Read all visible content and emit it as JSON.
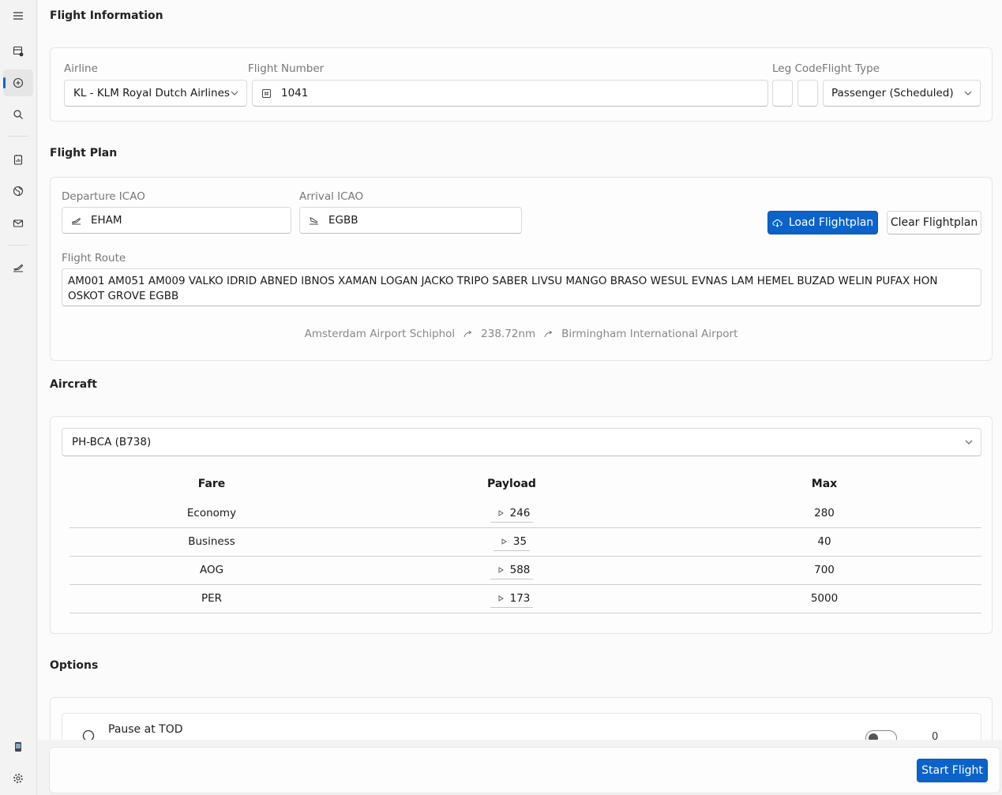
{
  "sidebar": {
    "items": [
      {
        "name": "menu-icon"
      },
      {
        "name": "dispatch-icon"
      },
      {
        "name": "flight-icon"
      },
      {
        "name": "search-icon"
      },
      {
        "name": "report-icon"
      },
      {
        "name": "globe-icon"
      },
      {
        "name": "mail-icon"
      },
      {
        "name": "logbook-icon"
      },
      {
        "name": "device-icon"
      },
      {
        "name": "settings-icon"
      }
    ]
  },
  "flight_info": {
    "title": "Flight Information",
    "airline_label": "Airline",
    "airline_value": "KL - KLM Royal Dutch Airlines",
    "flight_number_label": "Flight Number",
    "flight_number_value": "1041",
    "leg_code_label": "Leg Code",
    "flight_type_label": "Flight Type",
    "flight_type_value": "Passenger (Scheduled)"
  },
  "flight_plan": {
    "title": "Flight Plan",
    "departure_label": "Departure ICAO",
    "departure_value": "EHAM",
    "arrival_label": "Arrival ICAO",
    "arrival_value": "EGBB",
    "load_button": "Load Flightplan",
    "clear_button": "Clear Flightplan",
    "route_label": "Flight Route",
    "route_value": "AM001 AM051 AM009 VALKO IDRID ABNED IBNOS XAMAN LOGAN JACKO TRIPO SABER LIVSU MANGO BRASO WESUL EVNAS LAM HEMEL BUZAD WELIN PUFAX HON OSKOT GROVE EGBB",
    "departure_name": "Amsterdam Airport Schiphol",
    "distance": "238.72nm",
    "arrival_name": "Birmingham International Airport"
  },
  "aircraft": {
    "title": "Aircraft",
    "selected": "PH-BCA (B738)",
    "columns": [
      "Fare",
      "Payload",
      "Max"
    ],
    "rows": [
      {
        "fare": "Economy",
        "payload": "246",
        "max": "280"
      },
      {
        "fare": "Business",
        "payload": "35",
        "max": "40"
      },
      {
        "fare": "AOG",
        "payload": "588",
        "max": "700"
      },
      {
        "fare": "PER",
        "payload": "173",
        "max": "5000"
      }
    ]
  },
  "options": {
    "title": "Options",
    "pause_tod_label": "Pause at TOD",
    "pause_tod_value": "0"
  },
  "footer": {
    "start_button": "Start Flight"
  },
  "colors": {
    "accent": "#0b63c9"
  }
}
